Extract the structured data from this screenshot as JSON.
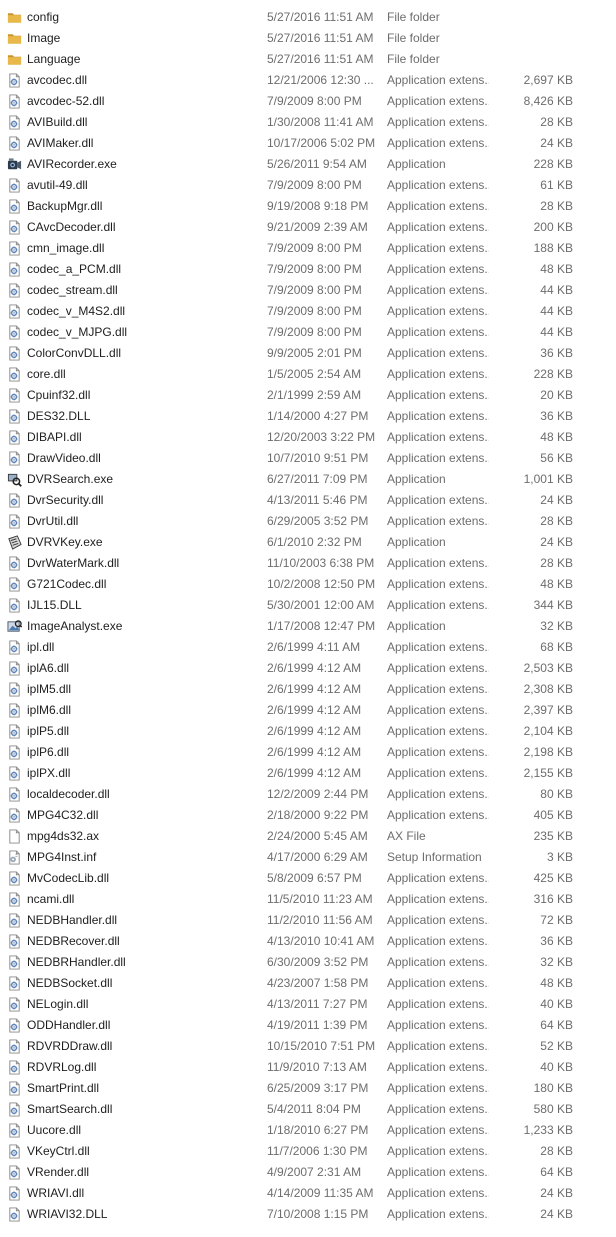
{
  "files": [
    {
      "name": "config",
      "date": "5/27/2016 11:51 AM",
      "type": "File folder",
      "size": "",
      "icon": "folder-icon"
    },
    {
      "name": "Image",
      "date": "5/27/2016 11:51 AM",
      "type": "File folder",
      "size": "",
      "icon": "folder-icon"
    },
    {
      "name": "Language",
      "date": "5/27/2016 11:51 AM",
      "type": "File folder",
      "size": "",
      "icon": "folder-icon"
    },
    {
      "name": "avcodec.dll",
      "date": "12/21/2006 12:30 ...",
      "type": "Application extens...",
      "size": "2,697 KB",
      "icon": "dll-icon"
    },
    {
      "name": "avcodec-52.dll",
      "date": "7/9/2009 8:00 PM",
      "type": "Application extens...",
      "size": "8,426 KB",
      "icon": "dll-icon"
    },
    {
      "name": "AVIBuild.dll",
      "date": "1/30/2008 11:41 AM",
      "type": "Application extens...",
      "size": "28 KB",
      "icon": "dll-icon"
    },
    {
      "name": "AVIMaker.dll",
      "date": "10/17/2006 5:02 PM",
      "type": "Application extens...",
      "size": "24 KB",
      "icon": "dll-icon"
    },
    {
      "name": "AVIRecorder.exe",
      "date": "5/26/2011 9:54 AM",
      "type": "Application",
      "size": "228 KB",
      "icon": "avi-recorder-icon"
    },
    {
      "name": "avutil-49.dll",
      "date": "7/9/2009 8:00 PM",
      "type": "Application extens...",
      "size": "61 KB",
      "icon": "dll-icon"
    },
    {
      "name": "BackupMgr.dll",
      "date": "9/19/2008 9:18 PM",
      "type": "Application extens...",
      "size": "28 KB",
      "icon": "dll-icon"
    },
    {
      "name": "CAvcDecoder.dll",
      "date": "9/21/2009 2:39 AM",
      "type": "Application extens...",
      "size": "200 KB",
      "icon": "dll-icon"
    },
    {
      "name": "cmn_image.dll",
      "date": "7/9/2009 8:00 PM",
      "type": "Application extens...",
      "size": "188 KB",
      "icon": "dll-icon"
    },
    {
      "name": "codec_a_PCM.dll",
      "date": "7/9/2009 8:00 PM",
      "type": "Application extens...",
      "size": "48 KB",
      "icon": "dll-icon"
    },
    {
      "name": "codec_stream.dll",
      "date": "7/9/2009 8:00 PM",
      "type": "Application extens...",
      "size": "44 KB",
      "icon": "dll-icon"
    },
    {
      "name": "codec_v_M4S2.dll",
      "date": "7/9/2009 8:00 PM",
      "type": "Application extens...",
      "size": "44 KB",
      "icon": "dll-icon"
    },
    {
      "name": "codec_v_MJPG.dll",
      "date": "7/9/2009 8:00 PM",
      "type": "Application extens...",
      "size": "44 KB",
      "icon": "dll-icon"
    },
    {
      "name": "ColorConvDLL.dll",
      "date": "9/9/2005 2:01 PM",
      "type": "Application extens...",
      "size": "36 KB",
      "icon": "dll-icon"
    },
    {
      "name": "core.dll",
      "date": "1/5/2005 2:54 AM",
      "type": "Application extens...",
      "size": "228 KB",
      "icon": "dll-icon"
    },
    {
      "name": "Cpuinf32.dll",
      "date": "2/1/1999 2:59 AM",
      "type": "Application extens...",
      "size": "20 KB",
      "icon": "dll-icon"
    },
    {
      "name": "DES32.DLL",
      "date": "1/14/2000 4:27 PM",
      "type": "Application extens...",
      "size": "36 KB",
      "icon": "dll-icon"
    },
    {
      "name": "DIBAPI.dll",
      "date": "12/20/2003 3:22 PM",
      "type": "Application extens...",
      "size": "48 KB",
      "icon": "dll-icon"
    },
    {
      "name": "DrawVideo.dll",
      "date": "10/7/2010 9:51 PM",
      "type": "Application extens...",
      "size": "56 KB",
      "icon": "dll-icon"
    },
    {
      "name": "DVRSearch.exe",
      "date": "6/27/2011 7:09 PM",
      "type": "Application",
      "size": "1,001 KB",
      "icon": "dvr-search-icon"
    },
    {
      "name": "DvrSecurity.dll",
      "date": "4/13/2011 5:46 PM",
      "type": "Application extens...",
      "size": "24 KB",
      "icon": "dll-icon"
    },
    {
      "name": "DvrUtil.dll",
      "date": "6/29/2005 3:52 PM",
      "type": "Application extens...",
      "size": "28 KB",
      "icon": "dll-icon"
    },
    {
      "name": "DVRVKey.exe",
      "date": "6/1/2010 2:32 PM",
      "type": "Application",
      "size": "24 KB",
      "icon": "dvr-vkey-icon"
    },
    {
      "name": "DvrWaterMark.dll",
      "date": "11/10/2003 6:38 PM",
      "type": "Application extens...",
      "size": "28 KB",
      "icon": "dll-icon"
    },
    {
      "name": "G721Codec.dll",
      "date": "10/2/2008 12:50 PM",
      "type": "Application extens...",
      "size": "48 KB",
      "icon": "dll-icon"
    },
    {
      "name": "IJL15.DLL",
      "date": "5/30/2001 12:00 AM",
      "type": "Application extens...",
      "size": "344 KB",
      "icon": "dll-icon"
    },
    {
      "name": "ImageAnalyst.exe",
      "date": "1/17/2008 12:47 PM",
      "type": "Application",
      "size": "32 KB",
      "icon": "image-analyst-icon"
    },
    {
      "name": "ipl.dll",
      "date": "2/6/1999 4:11 AM",
      "type": "Application extens...",
      "size": "68 KB",
      "icon": "dll-icon"
    },
    {
      "name": "iplA6.dll",
      "date": "2/6/1999 4:12 AM",
      "type": "Application extens...",
      "size": "2,503 KB",
      "icon": "dll-icon"
    },
    {
      "name": "iplM5.dll",
      "date": "2/6/1999 4:12 AM",
      "type": "Application extens...",
      "size": "2,308 KB",
      "icon": "dll-icon"
    },
    {
      "name": "iplM6.dll",
      "date": "2/6/1999 4:12 AM",
      "type": "Application extens...",
      "size": "2,397 KB",
      "icon": "dll-icon"
    },
    {
      "name": "iplP5.dll",
      "date": "2/6/1999 4:12 AM",
      "type": "Application extens...",
      "size": "2,104 KB",
      "icon": "dll-icon"
    },
    {
      "name": "iplP6.dll",
      "date": "2/6/1999 4:12 AM",
      "type": "Application extens...",
      "size": "2,198 KB",
      "icon": "dll-icon"
    },
    {
      "name": "iplPX.dll",
      "date": "2/6/1999 4:12 AM",
      "type": "Application extens...",
      "size": "2,155 KB",
      "icon": "dll-icon"
    },
    {
      "name": "localdecoder.dll",
      "date": "12/2/2009 2:44 PM",
      "type": "Application extens...",
      "size": "80 KB",
      "icon": "dll-icon"
    },
    {
      "name": "MPG4C32.dll",
      "date": "2/18/2000 9:22 PM",
      "type": "Application extens...",
      "size": "405 KB",
      "icon": "dll-icon"
    },
    {
      "name": "mpg4ds32.ax",
      "date": "2/24/2000 5:45 AM",
      "type": "AX File",
      "size": "235 KB",
      "icon": "blank-file-icon"
    },
    {
      "name": "MPG4Inst.inf",
      "date": "4/17/2000 6:29 AM",
      "type": "Setup Information",
      "size": "3 KB",
      "icon": "setup-info-icon"
    },
    {
      "name": "MvCodecLib.dll",
      "date": "5/8/2009 6:57 PM",
      "type": "Application extens...",
      "size": "425 KB",
      "icon": "dll-icon"
    },
    {
      "name": "ncami.dll",
      "date": "11/5/2010 11:23 AM",
      "type": "Application extens...",
      "size": "316 KB",
      "icon": "dll-icon"
    },
    {
      "name": "NEDBHandler.dll",
      "date": "11/2/2010 11:56 AM",
      "type": "Application extens...",
      "size": "72 KB",
      "icon": "dll-icon"
    },
    {
      "name": "NEDBRecover.dll",
      "date": "4/13/2010 10:41 AM",
      "type": "Application extens...",
      "size": "36 KB",
      "icon": "dll-icon"
    },
    {
      "name": "NEDBRHandler.dll",
      "date": "6/30/2009 3:52 PM",
      "type": "Application extens...",
      "size": "32 KB",
      "icon": "dll-icon"
    },
    {
      "name": "NEDBSocket.dll",
      "date": "4/23/2007 1:58 PM",
      "type": "Application extens...",
      "size": "48 KB",
      "icon": "dll-icon"
    },
    {
      "name": "NELogin.dll",
      "date": "4/13/2011 7:27 PM",
      "type": "Application extens...",
      "size": "40 KB",
      "icon": "dll-icon"
    },
    {
      "name": "ODDHandler.dll",
      "date": "4/19/2011 1:39 PM",
      "type": "Application extens...",
      "size": "64 KB",
      "icon": "dll-icon"
    },
    {
      "name": "RDVRDDraw.dll",
      "date": "10/15/2010 7:51 PM",
      "type": "Application extens...",
      "size": "52 KB",
      "icon": "dll-icon"
    },
    {
      "name": "RDVRLog.dll",
      "date": "11/9/2010 7:13 AM",
      "type": "Application extens...",
      "size": "40 KB",
      "icon": "dll-icon"
    },
    {
      "name": "SmartPrint.dll",
      "date": "6/25/2009 3:17 PM",
      "type": "Application extens...",
      "size": "180 KB",
      "icon": "dll-icon"
    },
    {
      "name": "SmartSearch.dll",
      "date": "5/4/2011 8:04 PM",
      "type": "Application extens...",
      "size": "580 KB",
      "icon": "dll-icon"
    },
    {
      "name": "Uucore.dll",
      "date": "1/18/2010 6:27 PM",
      "type": "Application extens...",
      "size": "1,233 KB",
      "icon": "dll-icon"
    },
    {
      "name": "VKeyCtrl.dll",
      "date": "11/7/2006 1:30 PM",
      "type": "Application extens...",
      "size": "28 KB",
      "icon": "dll-icon"
    },
    {
      "name": "VRender.dll",
      "date": "4/9/2007 2:31 AM",
      "type": "Application extens...",
      "size": "64 KB",
      "icon": "dll-icon"
    },
    {
      "name": "WRIAVI.dll",
      "date": "4/14/2009 11:35 AM",
      "type": "Application extens...",
      "size": "24 KB",
      "icon": "dll-icon"
    },
    {
      "name": "WRIAVI32.DLL",
      "date": "7/10/2008 1:15 PM",
      "type": "Application extens...",
      "size": "24 KB",
      "icon": "dll-icon"
    }
  ],
  "colors": {
    "folder": "#e8b84a",
    "folder_dark": "#c9952a",
    "dll_gear": "#5f85b8",
    "text_primary": "#1e1e1e",
    "text_secondary": "#6d6d6d",
    "hover": "#e5f3fb"
  }
}
